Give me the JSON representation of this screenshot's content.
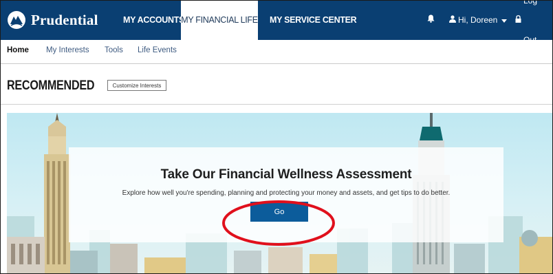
{
  "brand": {
    "name": "Prudential"
  },
  "nav": {
    "tabs": [
      {
        "label": "MY ACCOUNTS"
      },
      {
        "label": "MY FINANCIAL LIFE",
        "active": true
      },
      {
        "label": "MY SERVICE CENTER"
      }
    ],
    "user_greeting": "Hi, Doreen",
    "logout_label": "Log Out"
  },
  "subnav": {
    "items": [
      {
        "label": "Home",
        "active": true
      },
      {
        "label": "My Interests"
      },
      {
        "label": "Tools"
      },
      {
        "label": "Life Events"
      }
    ]
  },
  "section": {
    "title": "RECOMMENDED",
    "customize_label": "Customize Interests"
  },
  "hero": {
    "title": "Take Our Financial Wellness Assessment",
    "subtitle": "Explore how well you're spending, planning and protecting your money and assets, and get tips to do better.",
    "button_label": "Go"
  },
  "colors": {
    "nav_bg": "#0a3f72",
    "button_bg": "#0c5c9b",
    "highlight": "#e0101c"
  },
  "icons": [
    "prudential-rock-logo-icon",
    "bell-icon",
    "user-icon",
    "caret-down-icon",
    "lock-icon"
  ]
}
